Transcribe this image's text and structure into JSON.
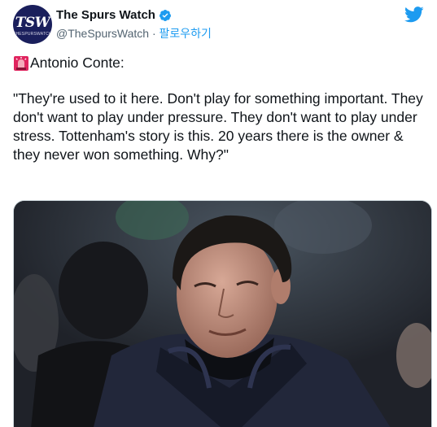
{
  "account": {
    "avatar_text": "TSW",
    "avatar_sub": "THESPURSWATCH",
    "display_name": "The Spurs Watch",
    "handle": "@TheSpursWatch",
    "separator": " · ",
    "follow_label": "팔로우하기"
  },
  "tweet": {
    "line1": "Antonio Conte:",
    "quote": "\"They're used to it here. Don't play for something important. They don't want to play under pressure. They don't want to play under stress. Tottenham's story is this. 20 years there is the owner & they never won something. Why?\""
  },
  "colors": {
    "brand_blue": "#1d9bf0",
    "text": "#0f1419",
    "secondary": "#536471",
    "avatar_bg": "#1a1f5c"
  },
  "icons": {
    "verified": "verified-badge-icon",
    "logo": "twitter-bird-icon",
    "emoji": "rotating-light-emoji-icon"
  }
}
